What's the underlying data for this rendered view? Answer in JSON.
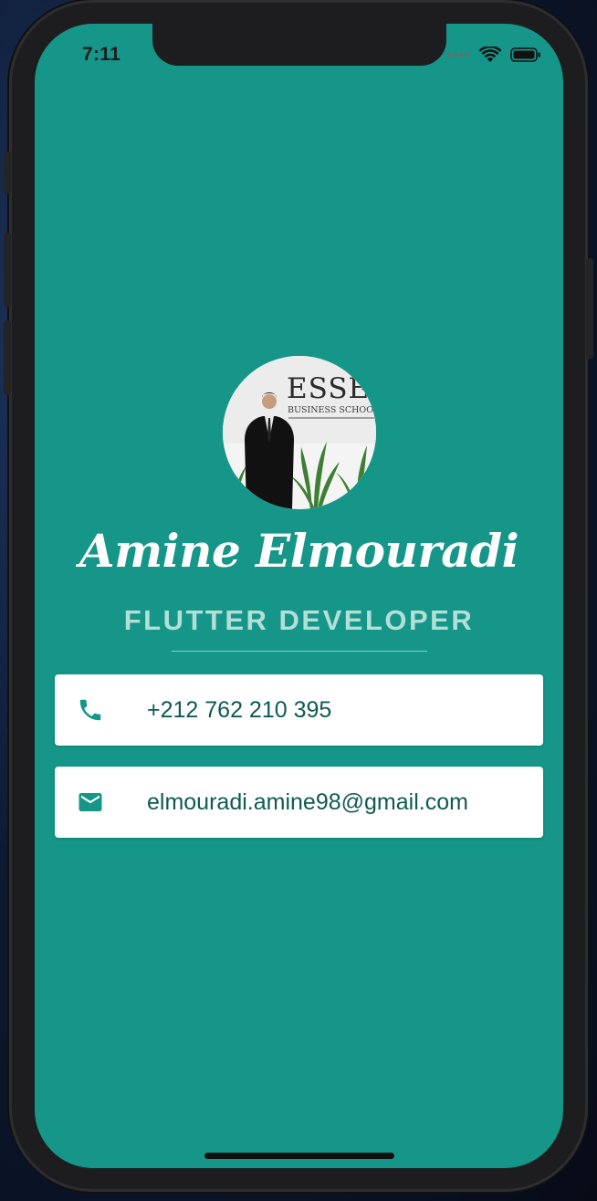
{
  "status_bar": {
    "time": "7:11",
    "icons": [
      "signal-dots-icon",
      "wifi-icon",
      "battery-icon"
    ]
  },
  "profile": {
    "avatar_icon": "profile-photo",
    "photo_sign_line1": "ESSEC",
    "photo_sign_line2": "BUSINESS SCHOOL",
    "name": "Amine Elmouradi",
    "title": "FLUTTER DEVELOPER"
  },
  "contacts": [
    {
      "icon": "phone-icon",
      "value": "+212 762 210 395"
    },
    {
      "icon": "email-icon",
      "value": "elmouradi.amine98@gmail.com"
    }
  ],
  "colors": {
    "background": "#159688",
    "title_text": "#b3dfd9",
    "card_background": "#ffffff",
    "card_text": "#0f5a52",
    "icon": "#159688"
  }
}
